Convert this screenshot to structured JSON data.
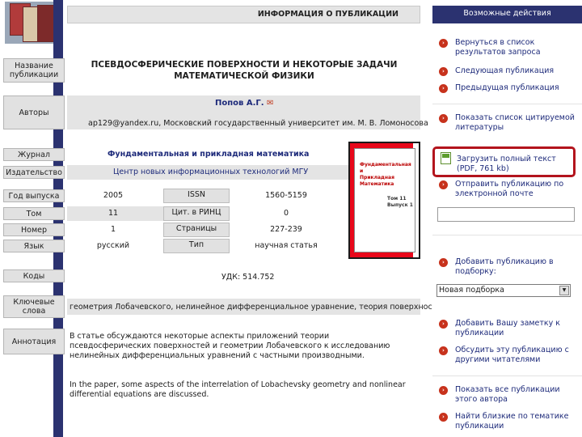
{
  "header": {
    "main_title": "ИНФОРМАЦИЯ О ПУБЛИКАЦИИ",
    "actions_title": "Возможные действия"
  },
  "labels": {
    "name": "Название публикации",
    "authors": "Авторы",
    "journal": "Журнал",
    "publisher": "Издательство",
    "year": "Год выпуска",
    "volume": "Том",
    "number": "Номер",
    "language": "Язык",
    "codes": "Коды",
    "keywords": "Ключевые слова",
    "abstract": "Аннотация"
  },
  "publication": {
    "title": "ПСЕВДОСФЕРИЧЕСКИЕ ПОВЕРХНОСТИ И НЕКОТОРЫЕ ЗАДАЧИ МАТЕМАТИЧЕСКОЙ ФИЗИКИ",
    "author": "Попов А.Г.",
    "affiliation": "ap129@yandex.ru, Московский государственный университет им. М. В. Ломоносова",
    "journal": "Фундаментальная и прикладная математика",
    "publisher": "Центр новых информационных технологий МГУ",
    "year": "2005",
    "issn_label": "ISSN",
    "issn": "1560-5159",
    "volume": "11",
    "citations_label": "Цит. в РИНЦ",
    "citations": "0",
    "number": "1",
    "pages_label": "Страницы",
    "pages": "227-239",
    "language": "русский",
    "type_label": "Тип",
    "type": "научная статья",
    "udc": "УДК: 514.752",
    "keywords": "геометрия Лобачевского,  нелинейное дифференциальное уравнение,  теория поверхностей",
    "abstract_ru": "В статье обсуждаются некоторые аспекты приложений теории псевдосферических поверхностей и геометрии Лобачевского к исследованию нелинейных дифференциальных уравнений с частными производными.",
    "abstract_en": "In the paper, some aspects of the interrelation of Lobachevsky geometry and nonlinear differential equations are discussed."
  },
  "cover": {
    "line1": "Фундаментальная",
    "line2": "и",
    "line3": "Прикладная",
    "line4": "Математика",
    "vol": "Том 11",
    "issue": "Выпуск 1"
  },
  "actions": [
    "Вернуться в список результатов запроса",
    "Следующая публикация",
    "Предыдущая публикация",
    "Показать список цитируемой литературы",
    "Загрузить полный текст (PDF, 761 kb)",
    "Отправить публикацию по электронной почте",
    "Добавить публикацию в подборку:",
    "Добавить Вашу заметку к публикации",
    "Обсудить эту публикацию с другими читателями",
    "Показать все публикации этого автора",
    "Найти близкие по тематике публикации"
  ],
  "selection": {
    "value": "Новая подборка"
  },
  "colors": {
    "navy": "#2b3270",
    "accent_red": "#b3141d",
    "link": "#1d2a7a"
  }
}
